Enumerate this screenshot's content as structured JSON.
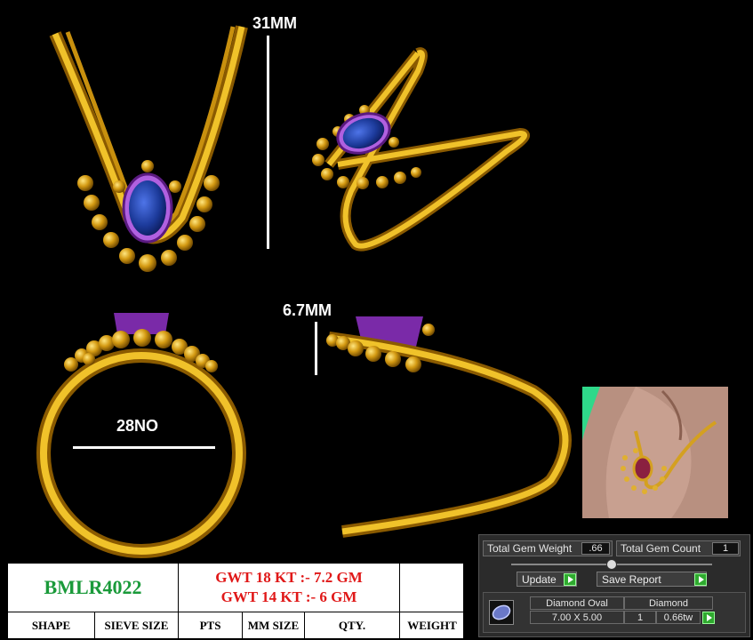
{
  "dimensions": {
    "height": "31MM",
    "depth": "6.7MM",
    "size": "28NO"
  },
  "spec_sheet": {
    "code": "BMLR4022",
    "gwt_18": "GWT 18 KT :- 7.2 GM",
    "gwt_14": "GWT 14 KT :- 6 GM",
    "headers": [
      "SHAPE",
      "SIEVE SIZE",
      "PTS",
      "MM SIZE",
      "QTY.",
      "WEIGHT"
    ]
  },
  "gem_panel": {
    "total_gem_weight_label": "Total Gem Weight",
    "total_gem_weight": ".66",
    "total_gem_count_label": "Total Gem Count",
    "total_gem_count": "1",
    "update_label": "Update",
    "save_report_label": "Save Report",
    "gem_name": "Diamond Oval",
    "gem_size": "7.00 X 5.00",
    "gem_type": "Diamond",
    "gem_qty": "1",
    "gem_weight": "0.66tw"
  },
  "colors": {
    "gold": "#e0a818",
    "sapphire": "#1c3a9a",
    "setting": "#7a2aa8",
    "code_green": "#1a9a3a",
    "weight_red": "#e01818"
  }
}
